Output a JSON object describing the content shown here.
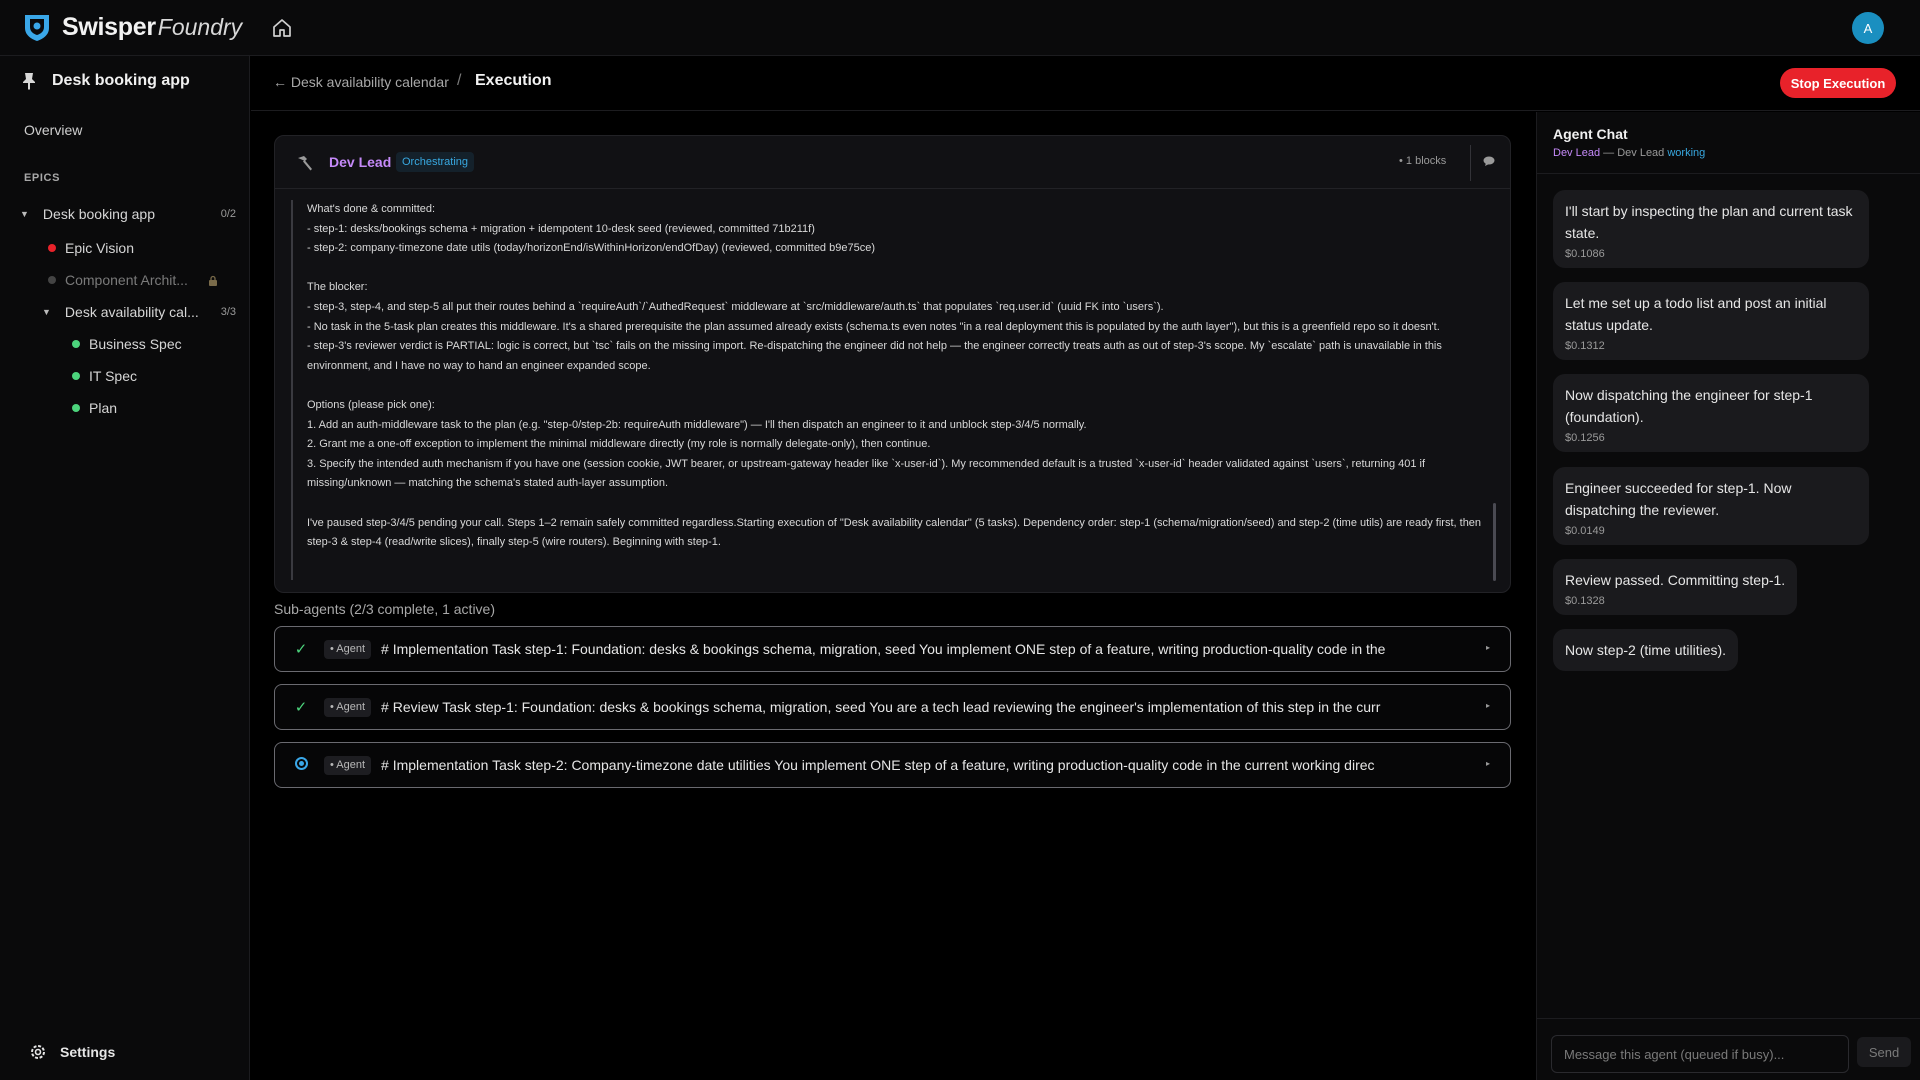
{
  "brand": {
    "name": "Swisper",
    "sub": "Foundry",
    "logo_icon": "shield-logo-icon"
  },
  "user": {
    "avatar_initial": "A"
  },
  "sidebar": {
    "project_title": "Desk booking app",
    "overview_label": "Overview",
    "epics_label": "EPICS",
    "tree": {
      "root": {
        "label": "Desk booking app",
        "count": "0/2"
      },
      "epic_vision": {
        "label": "Epic Vision",
        "status_color": "#e8222a"
      },
      "component_arch": {
        "label": "Component Archit...",
        "status_color": "#555555",
        "locked": true
      },
      "desk_availability": {
        "label": "Desk availability cal...",
        "count": "3/3"
      },
      "business_spec": {
        "label": "Business Spec",
        "status_color": "#4cd47c"
      },
      "it_spec": {
        "label": "IT Spec",
        "status_color": "#4cd47c"
      },
      "plan": {
        "label": "Plan",
        "status_color": "#4cd47c"
      }
    },
    "settings_label": "Settings"
  },
  "header": {
    "breadcrumb_back": "← Desk availability calendar",
    "separator": "/",
    "current": "Execution",
    "stop_label": "Stop Execution"
  },
  "agent": {
    "name": "Dev Lead",
    "status": "Orchestrating",
    "blocks": "• 1 blocks",
    "message_lines": [
      "What's done & committed:",
      "- step-1: desks/bookings schema + migration + idempotent 10-desk seed (reviewed, committed 71b211f)",
      "- step-2: company-timezone date utils (today/horizonEnd/isWithinHorizon/endOfDay) (reviewed, committed b9e75ce)",
      "",
      "The blocker:",
      "- step-3, step-4, and step-5 all put their routes behind a `requireAuth`/`AuthedRequest` middleware at `src/middleware/auth.ts` that populates `req.user.id` (uuid FK into `users`).",
      "- No task in the 5-task plan creates this middleware. It's a shared prerequisite the plan assumed already exists (schema.ts even notes \"in a real deployment this is populated by the auth layer\"), but this is a greenfield repo so it doesn't.",
      "- step-3's reviewer verdict is PARTIAL: logic is correct, but `tsc` fails on the missing import. Re-dispatching the engineer did not help — the engineer correctly treats auth as out of step-3's scope. My `escalate` path is unavailable in this environment, and I have no way to hand an engineer expanded scope.",
      "",
      "Options (please pick one):",
      "1. Add an auth-middleware task to the plan (e.g. \"step-0/step-2b: requireAuth middleware\") — I'll then dispatch an engineer to it and unblock step-3/4/5 normally.",
      "2. Grant me a one-off exception to implement the minimal middleware directly (my role is normally delegate-only), then continue.",
      "3. Specify the intended auth mechanism if you have one (session cookie, JWT bearer, or upstream-gateway header like `x-user-id`). My recommended default is a trusted `x-user-id` header validated against `users`, returning 401 if missing/unknown — matching the schema's stated auth-layer assumption.",
      "",
      "I've paused step-3/4/5 pending your call. Steps 1–2 remain safely committed regardless.Starting execution of \"Desk availability calendar\" (5 tasks). Dependency order: step-1 (schema/migration/seed) and step-2 (time utils) are ready first, then step-3 & step-4 (read/write slices), finally step-5 (wire routers). Beginning with step-1."
    ]
  },
  "subagents": {
    "label": "Sub-agents (2/3 complete, 1 active)",
    "items": [
      {
        "state": "complete",
        "badge": "• Agent",
        "text": "# Implementation Task step-1: Foundation: desks & bookings schema, migration, seed You implement ONE step of a feature, writing production-quality code in the"
      },
      {
        "state": "complete",
        "badge": "• Agent",
        "text": "# Review Task step-1: Foundation: desks & bookings schema, migration, seed You are a tech lead reviewing the engineer's implementation of this step in the curr"
      },
      {
        "state": "active",
        "badge": "• Agent",
        "text": "# Implementation Task step-2: Company-timezone date utilities You implement ONE step of a feature, writing production-quality code in the current working direc"
      }
    ],
    "check_glyph": "✓"
  },
  "chat": {
    "title": "Agent Chat",
    "who": "Dev Lead",
    "dash": " — Dev Lead ",
    "working": "working",
    "messages": [
      {
        "text": "I'll start by inspecting the plan and current task state.",
        "cost": "$0.1086"
      },
      {
        "text": "Let me set up a todo list and post an initial status update.",
        "cost": "$0.1312"
      },
      {
        "text": "Now dispatching the engineer for step-1 (foundation).",
        "cost": "$0.1256"
      },
      {
        "text": "Engineer succeeded for step-1. Now dispatching the reviewer.",
        "cost": "$0.0149"
      },
      {
        "text": "Review passed. Committing step-1.",
        "cost": "$0.1328"
      },
      {
        "text": "Now step-2 (time utilities).",
        "cost": ""
      }
    ],
    "input_placeholder": "Message this agent (queued if busy)...",
    "send_label": "Send"
  },
  "colors": {
    "accent": "#38a8e0",
    "danger": "#e8222a",
    "success": "#4cd47c",
    "agent": "#c58af9"
  }
}
